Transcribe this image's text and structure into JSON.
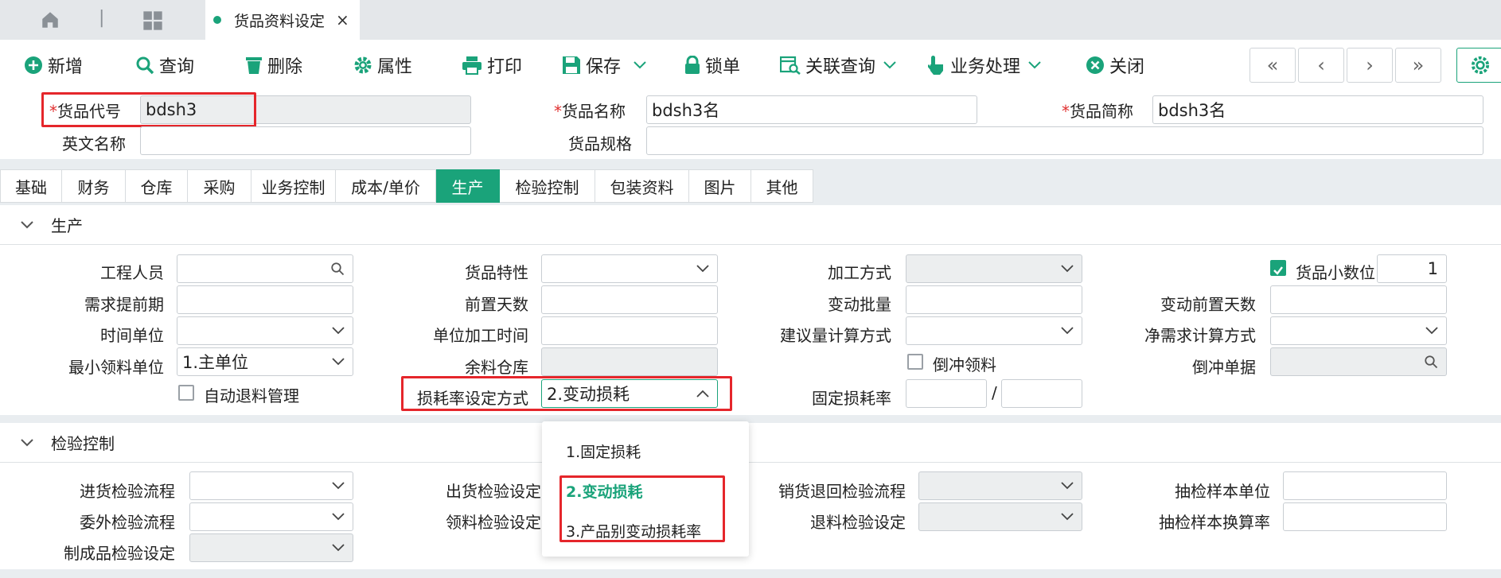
{
  "window": {
    "tab_title": "货品资料设定",
    "tab_close": "×",
    "tab_separator": "|"
  },
  "toolbar": {
    "new": "新增",
    "query": "查询",
    "delete": "删除",
    "properties": "属性",
    "print": "打印",
    "save": "保存",
    "lock": "锁单",
    "related_query": "关联查询",
    "business": "业务处理",
    "close": "关闭",
    "first": "«",
    "prev": "‹",
    "next": "›",
    "last": "»"
  },
  "header": {
    "code_label": "货品代号",
    "code_value": "bdsh3",
    "name_label": "货品名称",
    "name_value": "bdsh3名",
    "short_label": "货品简称",
    "short_value": "bdsh3名",
    "en_label": "英文名称",
    "en_value": "",
    "spec_label": "货品规格",
    "spec_value": "",
    "required_mark": "*"
  },
  "tabs": [
    "基础",
    "财务",
    "仓库",
    "采购",
    "业务控制",
    "成本/单价",
    "生产",
    "检验控制",
    "包装资料",
    "图片",
    "其他"
  ],
  "active_tab": "生产",
  "production": {
    "title": "生产",
    "engineer_label": "工程人员",
    "engineer_value": "",
    "demand_lead_label": "需求提前期",
    "time_unit_label": "时间单位",
    "min_issue_unit_label": "最小领料单位",
    "min_issue_unit_value": "1.主单位",
    "auto_return_label": "自动退料管理",
    "goods_feature_label": "货品特性",
    "lead_days_label": "前置天数",
    "unit_proc_time_label": "单位加工时间",
    "surplus_wh_label": "余料仓库",
    "loss_mode_label": "损耗率设定方式",
    "loss_mode_value": "2.变动损耗",
    "proc_method_label": "加工方式",
    "var_batch_label": "变动批量",
    "suggest_calc_label": "建议量计算方式",
    "backflush_label": "倒冲领料",
    "fixed_loss_label": "固定损耗率",
    "fixed_loss_sep": "/",
    "decimal_label": "货品小数位",
    "decimal_value": "1",
    "var_lead_days_label": "变动前置天数",
    "net_req_calc_label": "净需求计算方式",
    "backflush_doc_label": "倒冲单据"
  },
  "inspection": {
    "title": "检验控制",
    "incoming_flow_label": "进货检验流程",
    "outsource_flow_label": "委外检验流程",
    "finished_insp_label": "制成品检验设定",
    "outgoing_insp_label": "出货检验设定",
    "issue_insp_label": "领料检验设定",
    "sales_return_flow_label": "销货退回检验流程",
    "return_insp_label": "退料检验设定",
    "sample_unit_label": "抽检样本单位",
    "sample_rate_label": "抽检样本换算率"
  },
  "dropdown": {
    "options": [
      "1.固定损耗",
      "2.变动损耗",
      "3.产品别变动损耗率"
    ],
    "selected_index": 1
  },
  "colors": {
    "accent": "#1aa37a",
    "highlight": "#e5262b"
  }
}
